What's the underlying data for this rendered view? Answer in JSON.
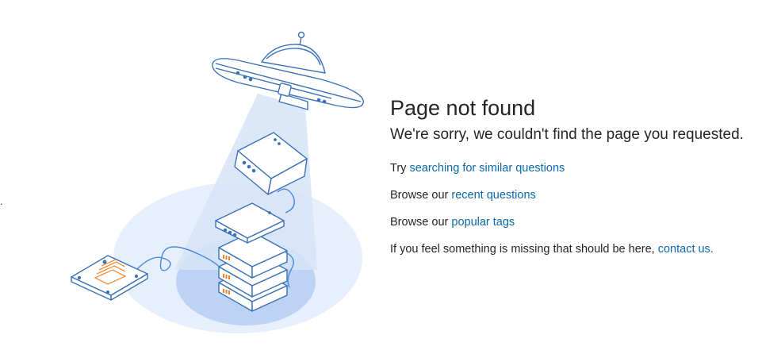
{
  "stray_mark": ".",
  "heading": {
    "title": "Page not found",
    "subtitle": "We're sorry, we couldn't find the page you requested."
  },
  "links": {
    "search": {
      "prefix": "Try ",
      "link": "searching for similar questions"
    },
    "recent": {
      "prefix": "Browse our ",
      "link": "recent questions"
    },
    "tags": {
      "prefix": "Browse our ",
      "link": "popular tags"
    },
    "contact": {
      "prefix": "If you feel something is missing that should be here, ",
      "link": "contact us."
    }
  },
  "colors": {
    "text": "#232629",
    "link": "#0a6aac",
    "outline": "#3b71b8",
    "accent": "#f48024",
    "beam": "#dce8f8",
    "ground": "#e6effb",
    "ground_inner": "#b9d0f2"
  },
  "illustration": {
    "icon": "ufo-abducting-servers-illustration"
  }
}
